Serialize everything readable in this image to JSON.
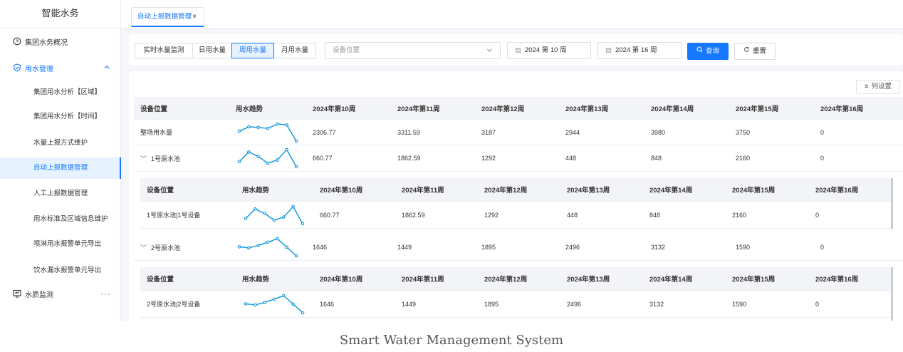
{
  "app": {
    "title": "智能水务"
  },
  "sidebar": {
    "group_overview": {
      "label": "集团水务概况",
      "icon": "clock-icon"
    },
    "group_water": {
      "label": "用水管理",
      "icon": "shield-icon"
    },
    "items": [
      {
        "label": "集团用水分析【区域】"
      },
      {
        "label": "集团用水分析【时间】"
      },
      {
        "label": "水量上报方式维护"
      },
      {
        "label": "自动上报数据管理"
      },
      {
        "label": "人工上报数据管理"
      },
      {
        "label": "用水标准及区域信息维护"
      },
      {
        "label": "喷淋用水报警单元导出"
      },
      {
        "label": "饮水漏水报警单元导出"
      }
    ],
    "group_quality": {
      "label": "水质监测",
      "icon": "monitor-icon",
      "more": "···"
    }
  },
  "tabs": {
    "active_label": "自动上报数据管理",
    "close": "×"
  },
  "filter": {
    "modes": [
      "实时水量监测",
      "日用水量",
      "周用水量",
      "月用水量"
    ],
    "active_mode": "周用水量",
    "location_placeholder": "设备位置",
    "start": "2024 第 10 周",
    "end": "2024 第 16 周",
    "query_label": "查询",
    "reset_label": "重置"
  },
  "table": {
    "settings_label": "列设置",
    "columns": [
      "设备位置",
      "用水趋势",
      "2024年第10周",
      "2024年第11周",
      "2024年第12周",
      "2024年第13周",
      "2024年第14周",
      "2024年第15周",
      "2024年第16周"
    ],
    "rows": [
      {
        "name": "整场用水量",
        "values": [
          "2306.77",
          "3311.59",
          "3187",
          "2944",
          "3980",
          "3750",
          "0"
        ]
      },
      {
        "name": "1号原水池",
        "values": [
          "660.77",
          "1862.59",
          "1292",
          "448",
          "848",
          "2160",
          "0"
        ]
      },
      {
        "name": "1号原水池|1号设备",
        "values": [
          "660.77",
          "1862.59",
          "1292",
          "448",
          "848",
          "2160",
          "0"
        ]
      },
      {
        "name": "2号原水池",
        "values": [
          "1646",
          "1449",
          "1895",
          "2496",
          "3132",
          "1590",
          "0"
        ]
      },
      {
        "name": "2号原水池|2号设备",
        "values": [
          "1646",
          "1449",
          "1895",
          "2496",
          "3132",
          "1590",
          "0"
        ]
      }
    ]
  },
  "colors": {
    "accent": "#1677ff",
    "spark": "#1a9bdc"
  },
  "caption": "Smart Water Management System"
}
